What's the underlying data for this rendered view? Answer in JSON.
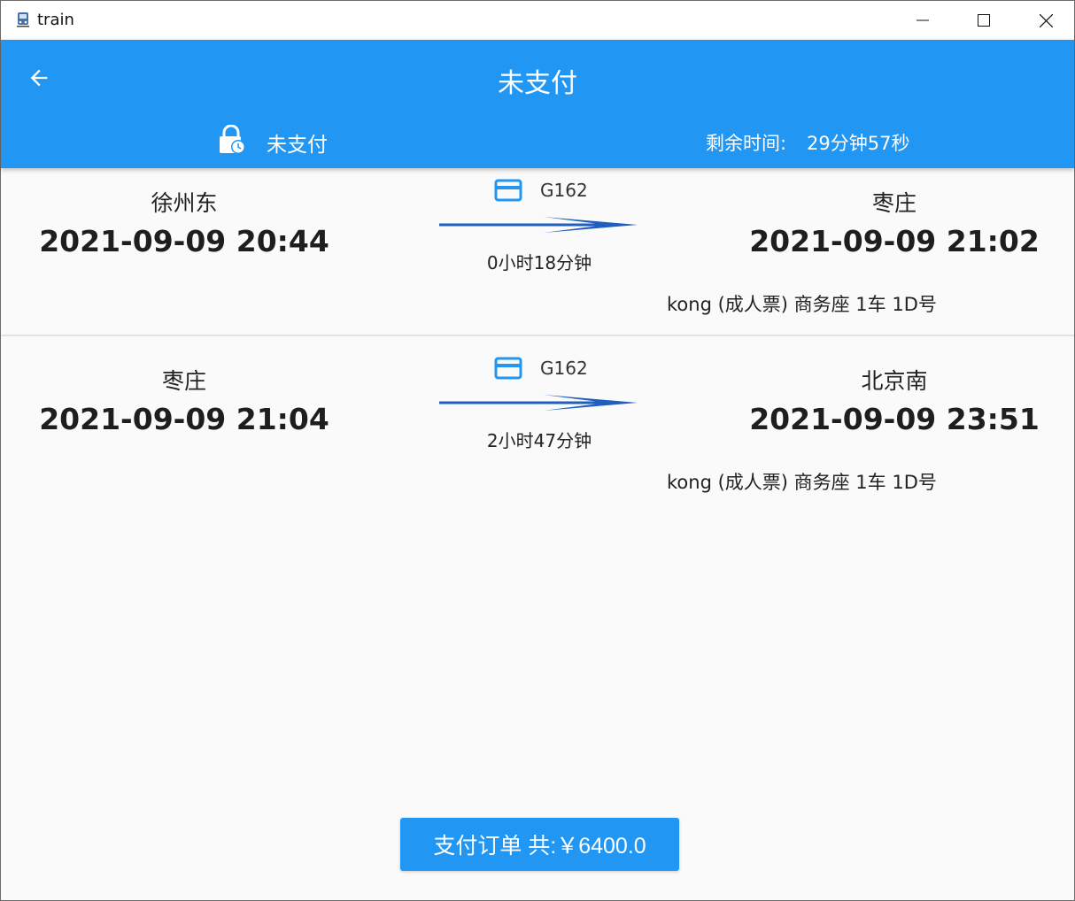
{
  "window": {
    "title": "train"
  },
  "appbar": {
    "title": "未支付"
  },
  "status": {
    "text": "未支付",
    "remaining_label": "剩余时间:",
    "remaining_value": "29分钟57秒"
  },
  "segments": [
    {
      "from_station": "徐州东",
      "from_time": "2021-09-09 20:44",
      "train_no": "G162",
      "duration": "0小时18分钟",
      "to_station": "枣庄",
      "to_time": "2021-09-09 21:02",
      "passenger": "kong  (成人票) 商务座 1车 1D号"
    },
    {
      "from_station": "枣庄",
      "from_time": "2021-09-09 21:04",
      "train_no": "G162",
      "duration": "2小时47分钟",
      "to_station": "北京南",
      "to_time": "2021-09-09 23:51",
      "passenger": "kong  (成人票) 商务座 1车 1D号"
    }
  ],
  "pay_button": {
    "label": "支付订单 共:￥6400.0"
  },
  "colors": {
    "primary": "#2196f3",
    "arrow": "#1f5fbf",
    "background": "#fafafa"
  }
}
